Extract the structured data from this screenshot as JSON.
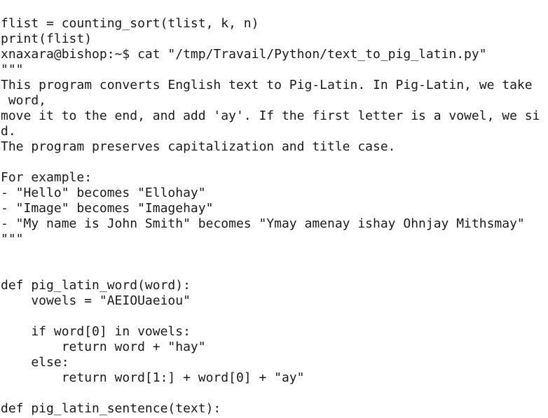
{
  "terminal": {
    "lines": [
      "flist = counting_sort(tlist, k, n)",
      "print(flist)",
      "xnaxara@bishop:~$ cat \"/tmp/Travail/Python/text_to_pig_latin.py\"",
      "\"\"\"",
      "This program converts English text to Pig-Latin. In Pig-Latin, we take",
      " word,",
      "move it to the end, and add 'ay'. If the first letter is a vowel, we si",
      "d.",
      "The program preserves capitalization and title case.",
      "",
      "For example:",
      "- \"Hello\" becomes \"Ellohay\"",
      "- \"Image\" becomes \"Imagehay\"",
      "- \"My name is John Smith\" becomes \"Ymay amenay ishay Ohnjay Mithsmay\"",
      "\"\"\"",
      "",
      "",
      "def pig_latin_word(word):",
      "    vowels = \"AEIOUaeiou\"",
      "",
      "    if word[0] in vowels:",
      "        return word + \"hay\"",
      "    else:",
      "        return word[1:] + word[0] + \"ay\"",
      "",
      "def pig_latin_sentence(text):"
    ]
  }
}
